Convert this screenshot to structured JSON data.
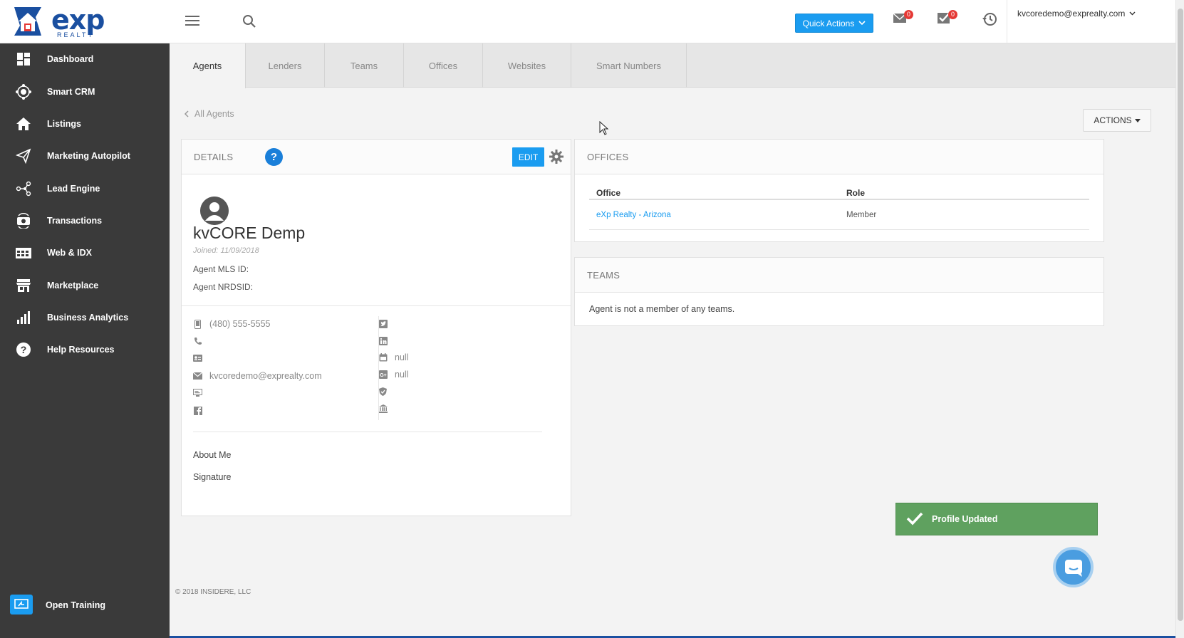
{
  "brand": {
    "logo_text": "exp",
    "logo_sub": "REALTY",
    "colors": {
      "primary": "#1a9cf0",
      "sidebar": "#3a3a3a",
      "success": "#5fa15f",
      "badge": "#e53935"
    }
  },
  "topbar": {
    "quick_actions": "Quick Actions",
    "mail_count": "0",
    "tasks_count": "0",
    "user_email": "kvcoredemo@exprealty.com"
  },
  "sidebar": {
    "items": [
      {
        "label": "Dashboard",
        "icon": "dashboard-icon"
      },
      {
        "label": "Smart CRM",
        "icon": "crm-icon"
      },
      {
        "label": "Listings",
        "icon": "home-icon"
      },
      {
        "label": "Marketing Autopilot",
        "icon": "paper-plane-icon"
      },
      {
        "label": "Lead Engine",
        "icon": "lead-engine-icon"
      },
      {
        "label": "Transactions",
        "icon": "transactions-icon"
      },
      {
        "label": "Web & IDX",
        "icon": "web-icon"
      },
      {
        "label": "Marketplace",
        "icon": "store-icon"
      },
      {
        "label": "Business Analytics",
        "icon": "bar-chart-icon"
      },
      {
        "label": "Help Resources",
        "icon": "question-icon"
      }
    ],
    "open_training": "Open Training"
  },
  "tabs": [
    "Agents",
    "Lenders",
    "Teams",
    "Offices",
    "Websites",
    "Smart Numbers"
  ],
  "breadcrumb": {
    "back": "All Agents"
  },
  "actions_label": "ACTIONS",
  "details": {
    "title": "DETAILS",
    "help": "?",
    "edit": "EDIT",
    "name": "kvCORE Demp",
    "joined": "Joined: 11/09/2018",
    "mls_label": "Agent MLS ID:",
    "nrds_label": "Agent NRDSID:",
    "contact_left": {
      "mobile": "(480) 555-5555",
      "phone": "",
      "id_card": "",
      "email": "kvcoredemo@exprealty.com",
      "website": "",
      "facebook": ""
    },
    "contact_right": {
      "twitter": "",
      "linkedin": "",
      "calendar": "null",
      "google_plus": "null",
      "shield": "",
      "bank": ""
    },
    "about_label": "About Me",
    "signature_label": "Signature"
  },
  "offices": {
    "title": "OFFICES",
    "columns": [
      "Office",
      "Role"
    ],
    "rows": [
      {
        "office": "eXp Realty - Arizona",
        "role": "Member"
      }
    ]
  },
  "teams": {
    "title": "TEAMS",
    "empty": "Agent is not a member of any teams."
  },
  "footer": "© 2018 INSIDERE, LLC",
  "toast": "Profile Updated"
}
